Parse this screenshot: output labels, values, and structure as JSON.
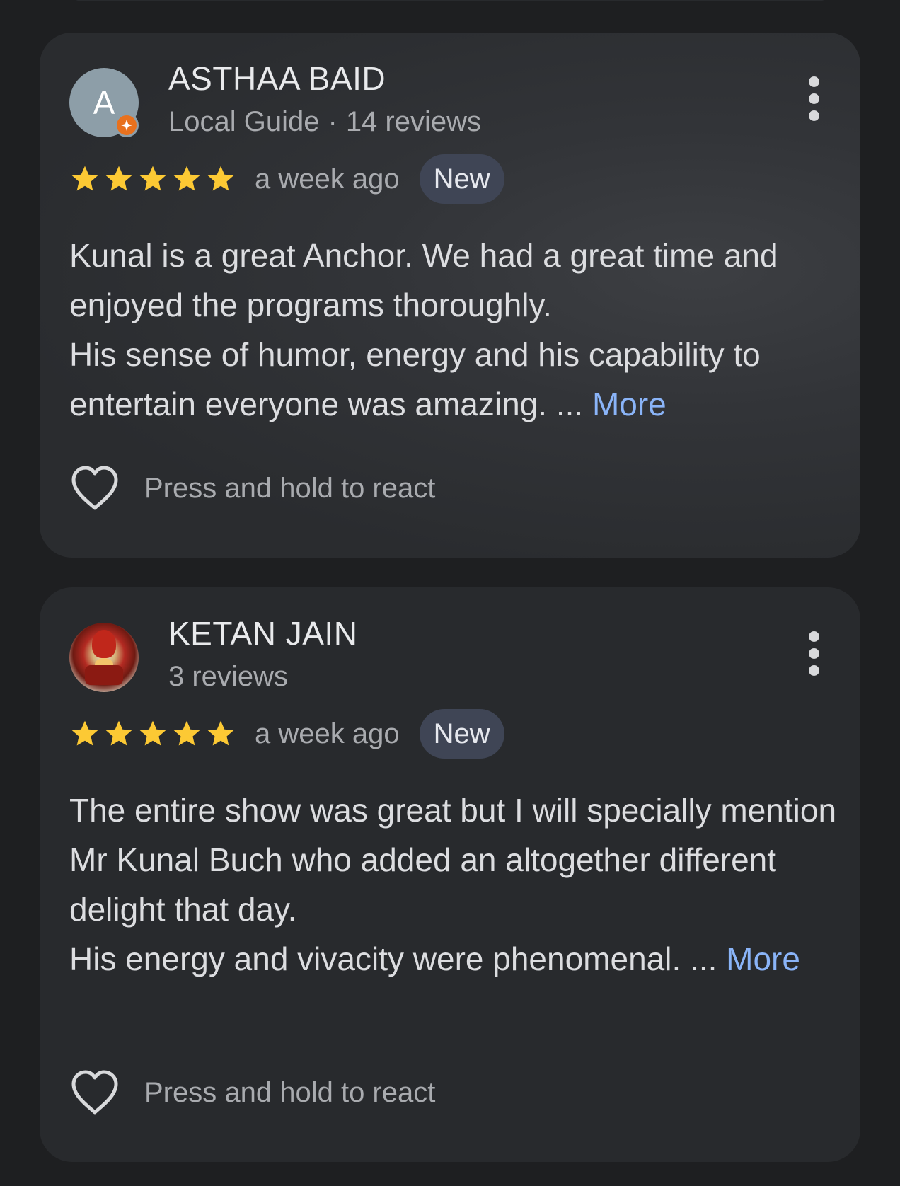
{
  "reviews": [
    {
      "name": "ASTHAA BAID",
      "avatar_letter": "A",
      "local_guide": true,
      "meta_guide": "Local Guide",
      "meta_dot": "·",
      "meta_reviews": "14 reviews",
      "rating": 5,
      "time": "a week ago",
      "badge": "New",
      "text_line1": "Kunal is a great Anchor. We had a great time and enjoyed the programs thoroughly.",
      "text_line2": "His sense of humor, energy and his capability to entertain everyone was amazing. ...",
      "more": "More",
      "react": "Press and hold to react"
    },
    {
      "name": "KETAN JAIN",
      "meta_reviews": "3 reviews",
      "rating": 5,
      "time": "a week ago",
      "badge": "New",
      "text_line1": "The entire show was great but I will specially mention Mr Kunal Buch who added an altogether different delight that day.",
      "text_line2": "His energy and vivacity were phenomenal. ...",
      "more": "More",
      "react": "Press and hold to react"
    }
  ],
  "colors": {
    "background": "#1e1f21",
    "card": "#282a2d",
    "star": "#fcc934",
    "link": "#8ab4f8",
    "badge": "#3f4555",
    "local_guide_badge": "#e8711e"
  }
}
